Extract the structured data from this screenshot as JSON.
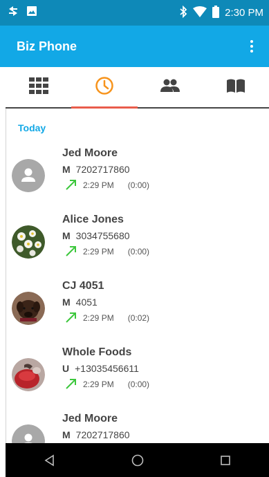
{
  "status_bar": {
    "time": "2:30 PM"
  },
  "app_bar": {
    "title": "Biz Phone"
  },
  "tabs": [
    {
      "name": "dialpad",
      "icon": "dialpad-icon"
    },
    {
      "name": "recents",
      "icon": "clock-icon",
      "active": true
    },
    {
      "name": "contacts",
      "icon": "people-icon"
    },
    {
      "name": "directory",
      "icon": "book-icon"
    }
  ],
  "colors": {
    "status_bar": "#0e89b8",
    "app_bar": "#12a8e6",
    "accent": "#f7941d",
    "tab_indicator": "#e95c4b",
    "outgoing_arrow": "#3cc73c"
  },
  "recents": {
    "section_label": "Today",
    "calls": [
      {
        "name": "Jed Moore",
        "number_type": "M",
        "number": "7202717860",
        "time": "2:29 PM",
        "duration": "(0:00)",
        "direction": "outgoing",
        "avatar": "default-person"
      },
      {
        "name": "Alice Jones",
        "number_type": "M",
        "number": "3034755680",
        "time": "2:29 PM",
        "duration": "(0:00)",
        "direction": "outgoing",
        "avatar": "photo-flowers"
      },
      {
        "name": "CJ 4051",
        "number_type": "M",
        "number": "4051",
        "time": "2:29 PM",
        "duration": "(0:02)",
        "direction": "outgoing",
        "avatar": "photo-dog"
      },
      {
        "name": "Whole Foods",
        "number_type": "U",
        "number": "+13035456611",
        "time": "2:29 PM",
        "duration": "(0:00)",
        "direction": "outgoing",
        "avatar": "photo-red"
      },
      {
        "name": "Jed Moore",
        "number_type": "M",
        "number": "7202717860",
        "time": "",
        "duration": "",
        "direction": "outgoing",
        "avatar": "default-person"
      }
    ]
  }
}
